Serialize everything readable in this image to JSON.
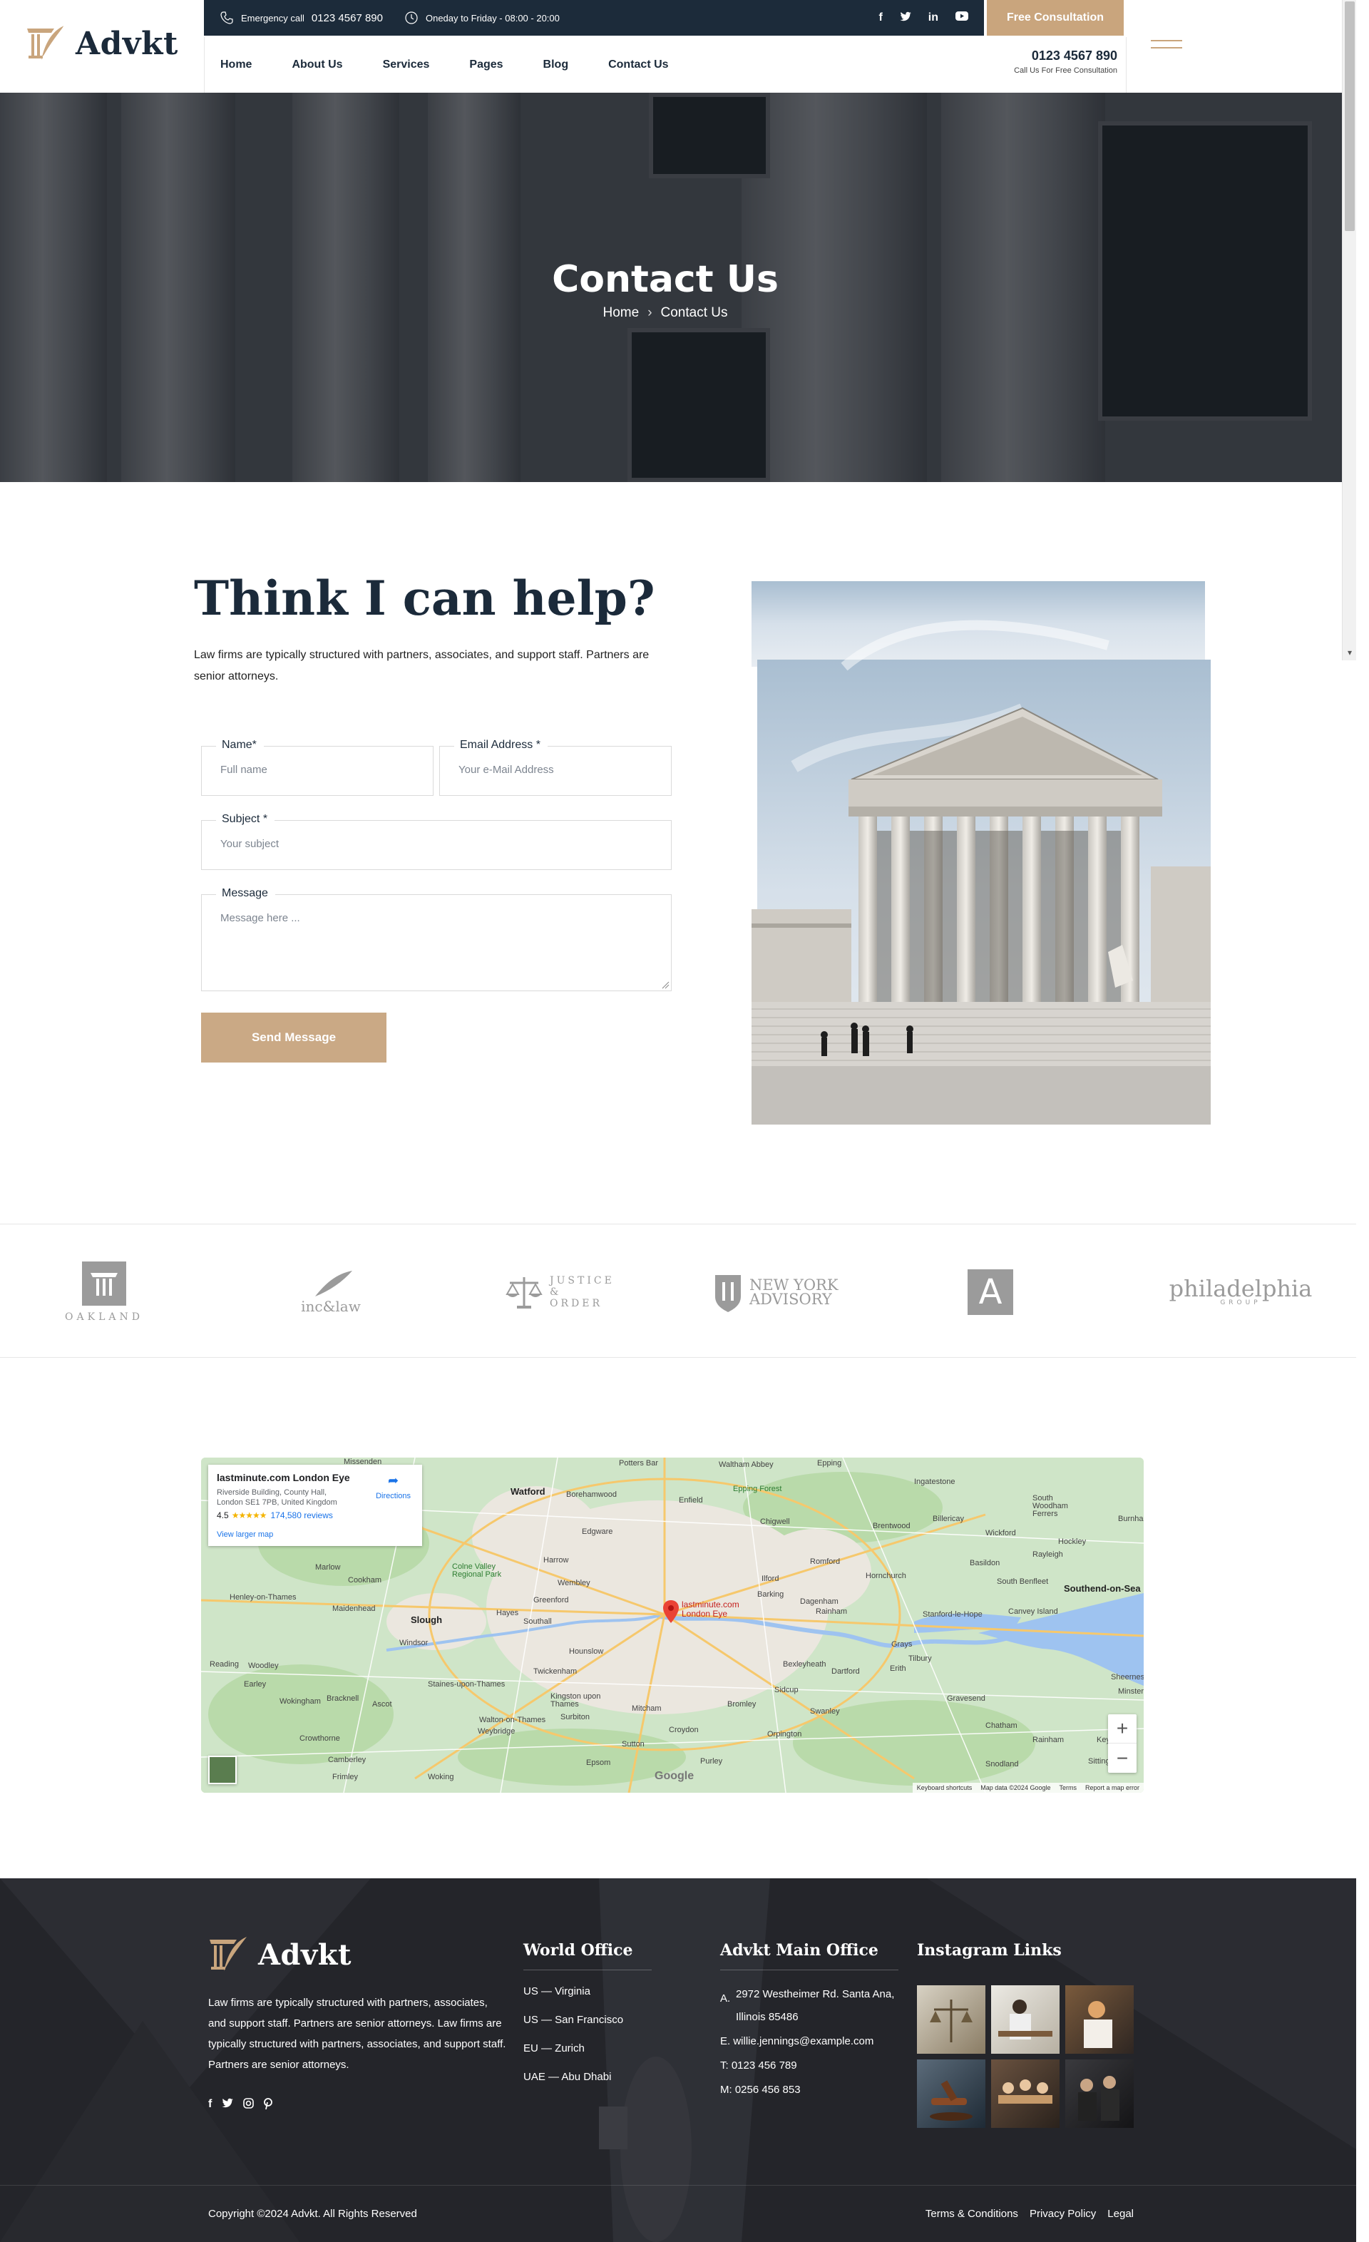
{
  "brand": {
    "name": "Advkt"
  },
  "topbar": {
    "emergency_label": "Emergency call",
    "emergency_phone": "0123 4567 890",
    "hours": "Oneday to Friday - 08:00 - 20:00",
    "cta": "Free Consultation",
    "socials": [
      "facebook-icon",
      "twitter-icon",
      "linkedin-icon",
      "youtube-icon"
    ]
  },
  "nav": {
    "items": [
      "Home",
      "About Us",
      "Services",
      "Pages",
      "Blog",
      "Contact Us"
    ],
    "phone": "0123 4567 890",
    "phone_sub": "Call Us For Free Consultation"
  },
  "hero": {
    "title": "Contact Us",
    "breadcrumb_home": "Home",
    "breadcrumb_sep": "›",
    "breadcrumb_current": "Contact Us"
  },
  "contact": {
    "title": "Think I can help?",
    "description": "Law firms are typically structured with partners, associates, and support staff. Partners are senior attorneys.",
    "form": {
      "name_label": "Name*",
      "name_placeholder": "Full name",
      "email_label": "Email Address *",
      "email_placeholder": "Your e-Mail Address",
      "subject_label": "Subject *",
      "subject_placeholder": "Your subject",
      "message_label": "Message",
      "message_placeholder": "Message here ...",
      "submit": "Send Message"
    }
  },
  "brands": [
    "OAKLAND",
    "inc&law",
    "JUSTICE & ORDER",
    "NEW YORK ADVISORY",
    "A",
    "philadelphia",
    "GROUP"
  ],
  "map": {
    "place_name": "lastminute.com London Eye",
    "address": "Riverside Building, County Hall, London SE1 7PB, United Kingdom",
    "rating": "4.5",
    "stars": "★★★★★",
    "reviews": "174,580 reviews",
    "directions": "Directions",
    "larger_map": "View larger map",
    "marker_label": "lastminute.com London Eye",
    "zoom_in": "+",
    "zoom_out": "−",
    "google": "Google",
    "attribution": [
      "Keyboard shortcuts",
      "Map data ©2024 Google",
      "Terms",
      "Report a map error"
    ],
    "places": [
      "Potters Bar",
      "Waltham Abbey",
      "Epping",
      "Watford",
      "Borehamwood",
      "Enfield",
      "Epping Forest",
      "Ingatestone",
      "South Woodham Ferrers",
      "Burnham",
      "Billericay",
      "Wickford",
      "Rayleigh",
      "Hockley",
      "Edgware",
      "Chigwell",
      "Brentwood",
      "Marlow",
      "Cookham",
      "Colne Valley Regional Park",
      "Harrow",
      "Wembley",
      "Romford",
      "Hornchurch",
      "Basildon",
      "South Benfleet",
      "Southend-on-Sea",
      "Henley-on-Thames",
      "Maidenhead",
      "Slough",
      "Hayes",
      "Greenford",
      "Southall",
      "Ilford",
      "Barking",
      "Dagenham",
      "Rainham",
      "Stanford-le-Hope",
      "Canvey Island",
      "Windsor",
      "Hounslow",
      "Reading",
      "Woodley",
      "Earley",
      "Staines-upon-Thames",
      "Twickenham",
      "Bexleyheath",
      "Dartford",
      "Grays",
      "Tilbury",
      "Erith",
      "Sheerness",
      "Wokingham",
      "Bracknell",
      "Ascot",
      "Kingston upon Thames",
      "Surbiton",
      "Mitcham",
      "Bromley",
      "Sidcup",
      "Swanley",
      "Gravesend",
      "Walton-on-Thames",
      "Weybridge",
      "Croydon",
      "Orpington",
      "Crowthorne",
      "Sutton",
      "Chatham",
      "Rainham",
      "Camberley",
      "Frimley",
      "Woking",
      "Epsom",
      "Purley",
      "Snodland",
      "Sittingbourne",
      "Missenden",
      "Minster",
      "Keynsham"
    ]
  },
  "footer": {
    "description": "Law firms are typically structured with partners, associates, and support staff. Partners are senior attorneys. Law firms are typically structured with partners, associates, and support staff. Partners are senior attorneys.",
    "socials": [
      "facebook-icon",
      "twitter-icon",
      "instagram-icon",
      "pinterest-icon"
    ],
    "world_office_title": "World Office",
    "world_offices": [
      "US — Virginia",
      "US — San Francisco",
      "EU — Zurich",
      "UAE — Abu Dhabi"
    ],
    "main_office_title": "Advkt Main Office",
    "address_prefix": "A.",
    "address_line1": "2972 Westheimer Rd. Santa Ana,",
    "address_line2": "Illinois 85486",
    "email": "E. willie.jennings@example.com",
    "tel": "T: 0123 456 789",
    "mobile": "M: 0256 456 853",
    "instagram_title": "Instagram Links",
    "copyright": "Copyright ©2024 Advkt. All Rights Reserved",
    "legal_links": [
      "Terms & Conditions",
      "Privacy Policy",
      "Legal"
    ]
  },
  "colors": {
    "accent": "#c9a57d",
    "navy": "#1c2b3a",
    "footer_bg": "#24252a"
  }
}
